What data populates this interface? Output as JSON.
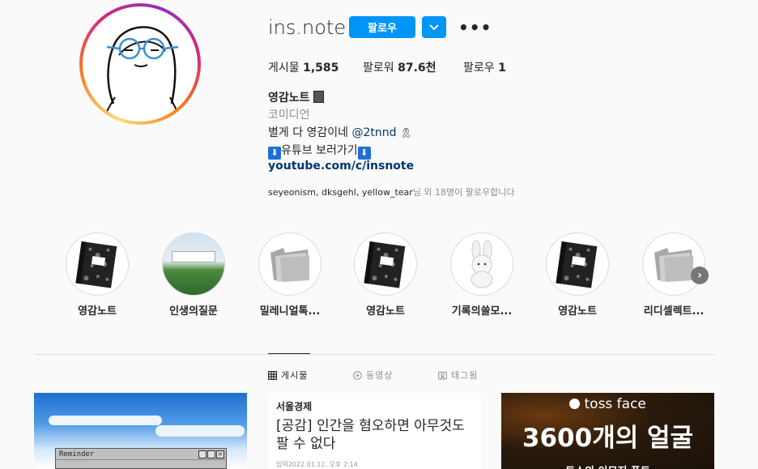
{
  "profile": {
    "username": "ins.note",
    "follow_label": "팔로우",
    "more_label": "•••",
    "stats": {
      "posts_label": "게시물",
      "posts_value": "1,585",
      "followers_label": "팔로워",
      "followers_value": "87.6천",
      "following_label": "팔로우",
      "following_value": "1"
    },
    "name": "영감노트",
    "category": "코미디언",
    "bio_line1_text": "별게 다 영감이네 ",
    "bio_line1_mention": "@2tnnd",
    "bio_line2_text": "유튜브 보러가기",
    "bio_line2_badge": "⬇",
    "link": "youtube.com/c/insnote",
    "followed_by_names": "seyeonism, dksgehl, yellow_tear",
    "followed_by_suffix": "님 외 18명이 팔로우합니다"
  },
  "highlights": [
    {
      "label": "영감노트",
      "icon": "notebook-icon"
    },
    {
      "label": "인생의질문",
      "icon": "landscape-photo"
    },
    {
      "label": "밀레니얼톡...",
      "icon": "folder-icon"
    },
    {
      "label": "영감노트",
      "icon": "notebook-icon"
    },
    {
      "label": "기록의쓸모...",
      "icon": "bunny-plush"
    },
    {
      "label": "영감노트",
      "icon": "notebook-icon"
    },
    {
      "label": "리디셀렉트...",
      "icon": "folder-icon"
    }
  ],
  "tabs": [
    {
      "label": "게시물",
      "icon": "grid-icon",
      "active": true
    },
    {
      "label": "동영상",
      "icon": "play-icon",
      "active": false
    },
    {
      "label": "태그됨",
      "icon": "tag-icon",
      "active": false
    }
  ],
  "posts": {
    "post1_window_title": "Reminder",
    "post2_source": "서울경제",
    "post2_headline": "[공감] 인간을 혐오하면 아무것도 팔 수 없다",
    "post2_date": "입력2022.01.12. 오후 2:14",
    "post3_brand": "toss face",
    "post3_headline": "3600개의 얼굴",
    "post3_sub": "토스의 이모지 폰트"
  },
  "colors": {
    "primary_button": "#0095f6",
    "link": "#00376b",
    "muted": "#8e8e8e"
  }
}
